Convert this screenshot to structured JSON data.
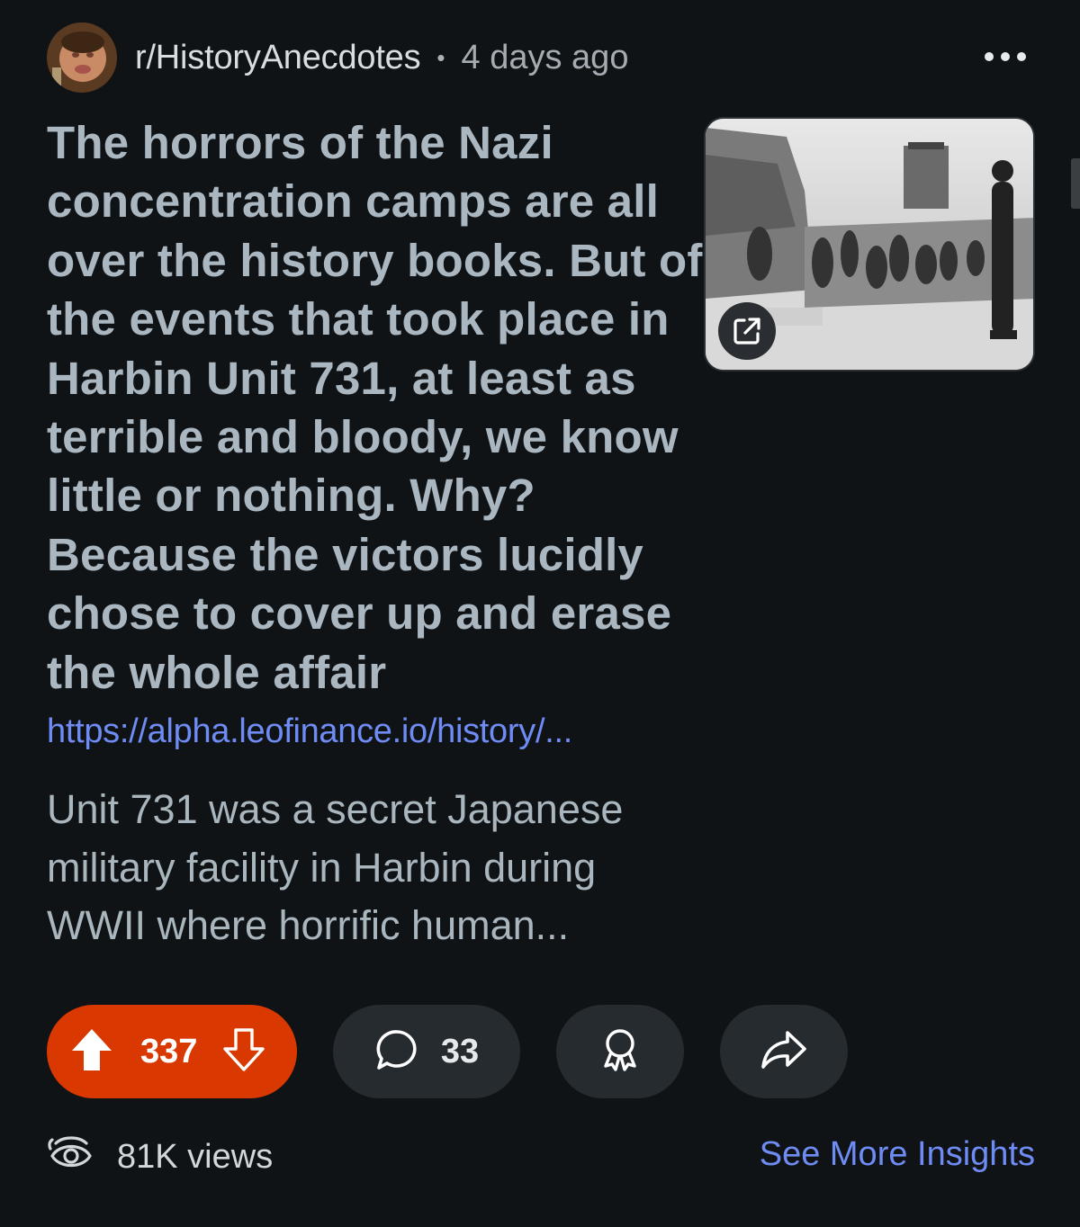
{
  "post": {
    "subreddit": "r/HistoryAnecdotes",
    "separator": "•",
    "age": "4 days ago",
    "title": "The horrors of the Nazi concentration camps are all over the history books. But of the events that took place in Harbin Unit 731, at least as terrible and bloody, we know little or nothing. Why? Because the victors lucidly chose to cover up and erase the whole affair",
    "link": "https://alpha.leofinance.io/history/...",
    "body": "Unit 731 was a secret Japanese military facility in Harbin during WWII where horrific human..."
  },
  "icons": {
    "more": "more-options-icon",
    "external": "external-link-icon",
    "upvote": "upvote-arrow-icon",
    "downvote": "downvote-arrow-icon",
    "comment": "comment-bubble-icon",
    "award": "award-ribbon-icon",
    "share": "share-arrow-icon",
    "views": "views-eye-icon"
  },
  "actions": {
    "score": "337",
    "comments": "33"
  },
  "footer": {
    "views": "81K views",
    "insights": "See More Insights"
  },
  "colors": {
    "background": "#101316",
    "upvote_active": "#d93900",
    "pill": "#262b30",
    "link": "#6f8cf5",
    "title": "#aab7c1"
  }
}
